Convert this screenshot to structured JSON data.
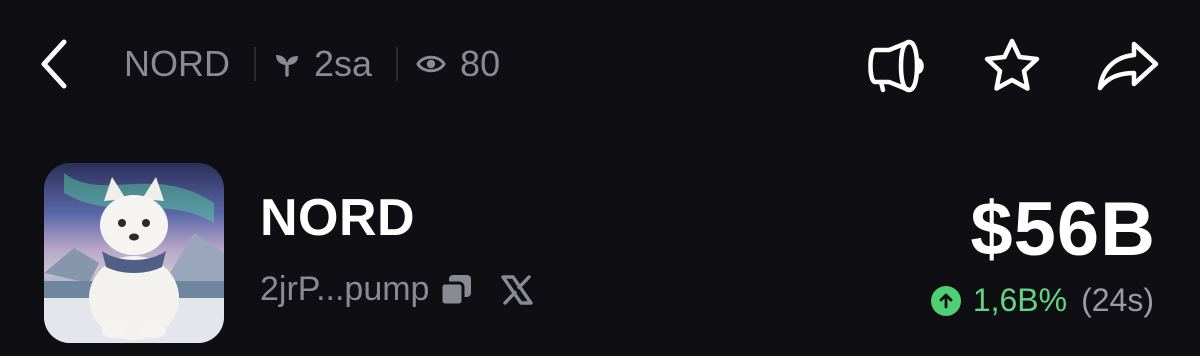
{
  "header": {
    "back_icon": "chevron-left-icon",
    "token_label": "NORD",
    "age_icon": "sprout-icon",
    "age": "2sa",
    "views_icon": "eye-icon",
    "views": "80",
    "actions": [
      "megaphone-icon",
      "star-icon",
      "share-arrow-icon"
    ]
  },
  "token": {
    "name": "NORD",
    "address": "2jrP...pump",
    "copy_icon": "copy-icon",
    "social_icon": "x-logo-icon",
    "market_cap": "$56B",
    "change": "1,6B%",
    "period": "(24s)",
    "change_icon": "arrow-up-circle-icon"
  },
  "colors": {
    "background": "#0f0e12",
    "muted_text": "#8a8a93",
    "positive": "#63d481"
  }
}
